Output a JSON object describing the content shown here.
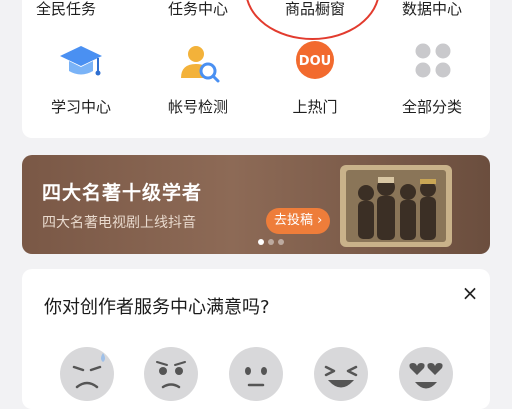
{
  "tools": {
    "row1": [
      {
        "label": "全民任务"
      },
      {
        "label": "任务中心"
      },
      {
        "label": "商品橱窗"
      },
      {
        "label": "数据中心"
      }
    ],
    "row2": [
      {
        "label": "学习中心",
        "icon": "graduation-cap-icon"
      },
      {
        "label": "帐号检测",
        "icon": "account-check-icon"
      },
      {
        "label": "上热门",
        "icon": "dou-plus-icon"
      },
      {
        "label": "全部分类",
        "icon": "grid-dots-icon"
      }
    ],
    "dou_badge": "DOU"
  },
  "banner": {
    "title": "四大名著十级学者",
    "subtitle": "四大名著电视剧上线抖音",
    "button": "去投稿 ›",
    "page_count": 3,
    "active_page": 1
  },
  "survey": {
    "question": "你对创作者服务中心满意吗?",
    "close": "×",
    "options": [
      "very-dissatisfied-emoji",
      "dissatisfied-emoji",
      "neutral-emoji",
      "satisfied-emoji",
      "very-satisfied-emoji"
    ]
  },
  "colors": {
    "highlight": "#e23b2e",
    "accent_orange": "#ee7d3a",
    "banner_brown": "#7a5846",
    "learn_blue": "#4a90f2",
    "account_yellow": "#f3b23a"
  }
}
